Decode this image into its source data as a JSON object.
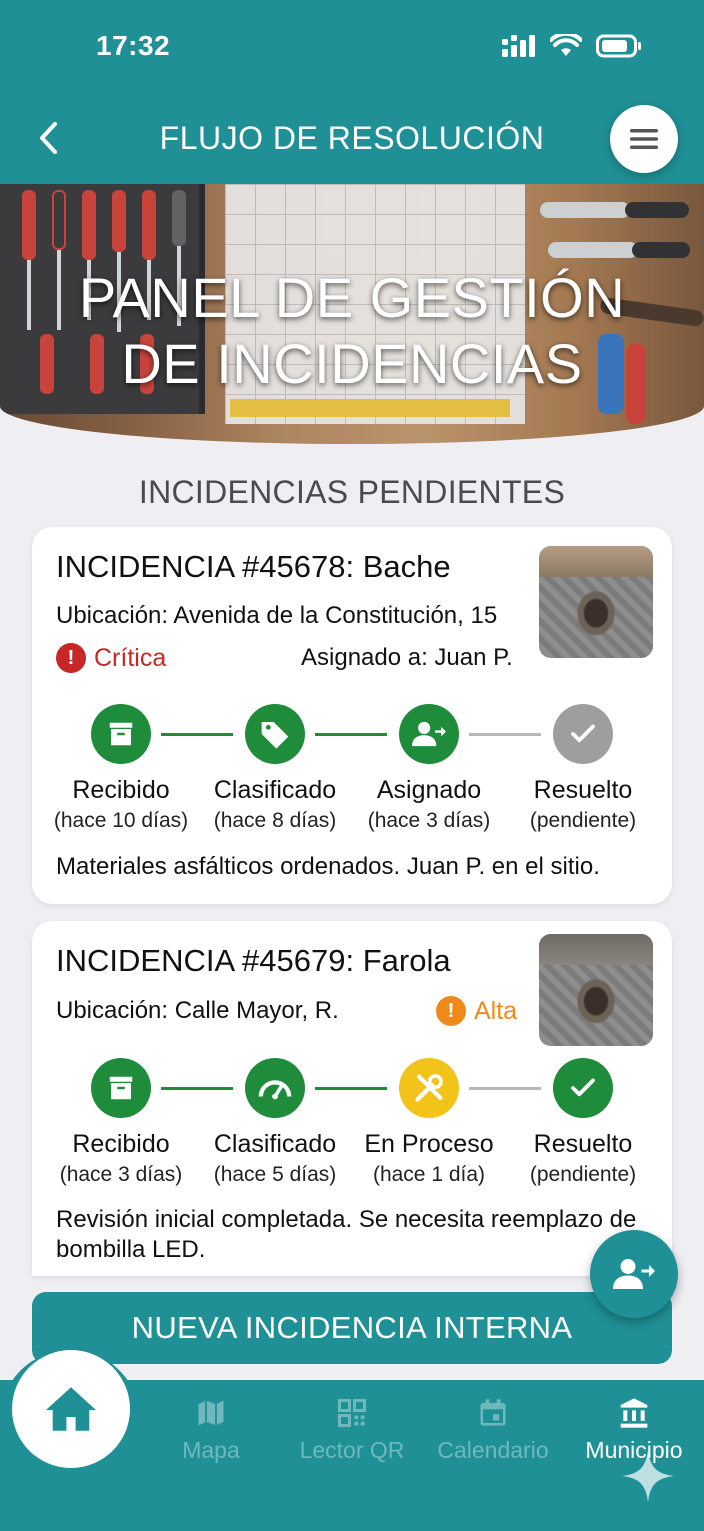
{
  "status_bar": {
    "time": "17:32"
  },
  "header": {
    "title": "FLUJO DE RESOLUCIÓN"
  },
  "hero": {
    "title_line1": "PANEL DE GESTIÓN",
    "title_line2": "DE INCIDENCIAS"
  },
  "section": {
    "title": "INCIDENCIAS PENDIENTES"
  },
  "incidents": [
    {
      "title": "INCIDENCIA #45678: Bache",
      "location": "Ubicación: Avenida de la Constitución, 15",
      "priority": "Crítica",
      "priority_color": "#c62828",
      "assigned": "Asignado a: Juan P.",
      "steps": [
        {
          "label": "Recibido",
          "sub": "(hace 10 días)",
          "icon": "archive-icon",
          "state": "done"
        },
        {
          "label": "Clasificado",
          "sub": "(hace 8 días)",
          "icon": "tag-icon",
          "state": "done"
        },
        {
          "label": "Asignado",
          "sub": "(hace 3 días)",
          "icon": "assign-user-icon",
          "state": "done"
        },
        {
          "label": "Resuelto",
          "sub": "(pendiente)",
          "icon": "check-icon",
          "state": "pending"
        }
      ],
      "note": "Materiales asfálticos ordenados. Juan P. en el sitio."
    },
    {
      "title": "INCIDENCIA #45679: Farola",
      "location": "Ubicación: Calle Mayor, R.",
      "priority": "Alta",
      "priority_color": "#ef8a1a",
      "steps": [
        {
          "label": "Recibido",
          "sub": "(hace 3 días)",
          "icon": "archive-icon",
          "state": "done"
        },
        {
          "label": "Clasificado",
          "sub": "(hace 5 días)",
          "icon": "gauge-icon",
          "state": "done"
        },
        {
          "label": "En Proceso",
          "sub": "(hace 1 día)",
          "icon": "tools-icon",
          "state": "in-progress"
        },
        {
          "label": "Resuelto",
          "sub": "(pendiente)",
          "icon": "check-icon",
          "state": "done"
        }
      ],
      "note": "Revisión inicial completada. Se necesita reemplazo de bombilla LED."
    }
  ],
  "actions": {
    "new_incident": "NUEVA INCIDENCIA INTERNA"
  },
  "nav": {
    "items": [
      {
        "label": "Mapa",
        "icon": "map-icon"
      },
      {
        "label": "Lector QR",
        "icon": "qr-icon"
      },
      {
        "label": "Calendario",
        "icon": "calendar-icon"
      },
      {
        "label": "Municipio",
        "icon": "bank-icon"
      }
    ],
    "active": "Municipio"
  },
  "colors": {
    "primary": "#1f9096",
    "green": "#1e8c3a",
    "grey": "#9e9e9e",
    "yellow": "#f2c318"
  }
}
